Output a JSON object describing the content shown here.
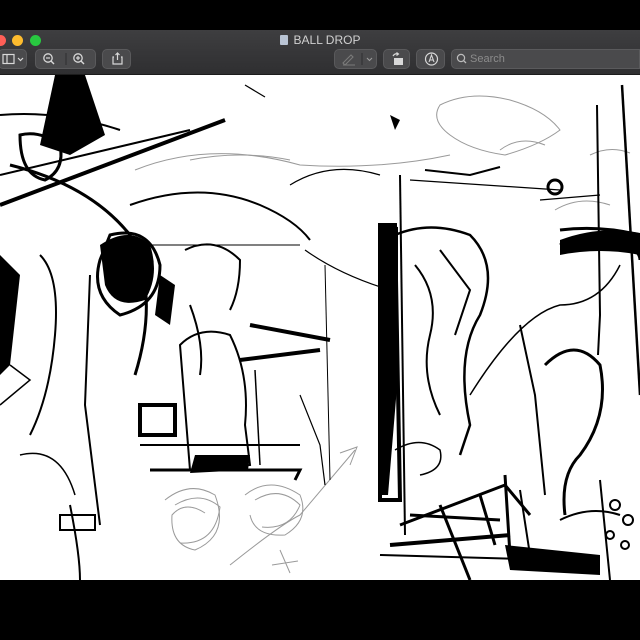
{
  "window": {
    "title": "BALL DROP"
  },
  "toolbar": {
    "sidebar_icon": "sidebar-icon",
    "zoom_out_icon": "zoom-out-icon",
    "zoom_in_icon": "zoom-in-icon",
    "share_icon": "share-icon",
    "markup_pen_icon": "pen-icon",
    "rotate_icon": "rotate-icon",
    "annotate_icon": "markup-icon",
    "search_placeholder": "Search"
  },
  "document": {
    "description_text": "",
    "colors": {
      "ink": "#000000",
      "pencil": "#9a9a9a",
      "paper": "#ffffff"
    }
  }
}
